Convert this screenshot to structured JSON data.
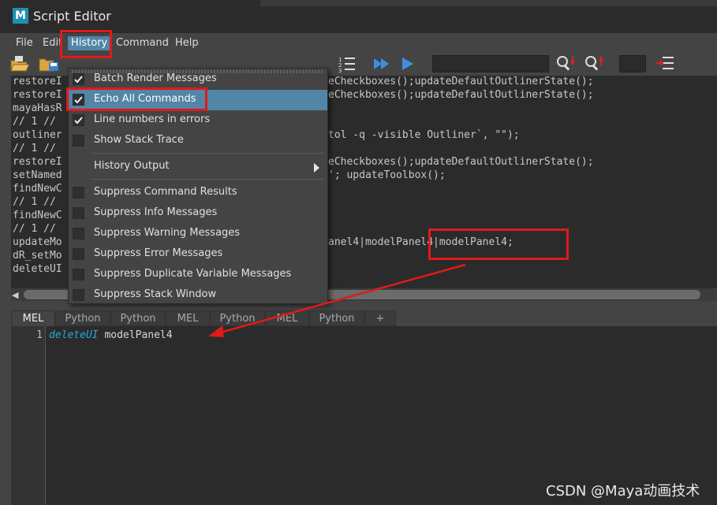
{
  "window": {
    "title": "Script Editor",
    "logo": "M"
  },
  "menubar": {
    "items": [
      "File",
      "Edit",
      "History",
      "Command",
      "Help"
    ],
    "open": "History"
  },
  "history_lines": [
    "restoreI",
    "restoreI",
    "mayaHasR",
    "// 1 //",
    "outliner",
    "// 1 //",
    "restoreI",
    "setNamed",
    "findNewC",
    "// 1 //",
    "findNewC",
    "// 1 //",
    "updateMo",
    "dR_setMo",
    "deleteUI"
  ],
  "history_tail": [
    "eCheckboxes();updateDefaultOutlinerState();",
    "eCheckboxes();updateDefaultOutlinerState();",
    "",
    "",
    "tol -q -visible Outliner`, \"\");",
    "",
    "eCheckboxes();updateDefaultOutlinerState();",
    "'; updateToolbox();",
    "",
    "",
    "",
    "",
    "anel4|modelPanel4|modelPanel4;",
    "",
    ""
  ],
  "dropdown": {
    "items": [
      {
        "label": "Batch Render Messages",
        "checked": true,
        "highlight": false
      },
      {
        "label": "Echo All Commands",
        "checked": true,
        "highlight": true
      },
      {
        "label": "Line numbers in errors",
        "checked": true,
        "highlight": false
      },
      {
        "label": "Show Stack Trace",
        "checked": false,
        "highlight": false
      },
      {
        "label": "History Output",
        "submenu": true
      },
      {
        "label": "Suppress Command Results",
        "checked": false,
        "highlight": false
      },
      {
        "label": "Suppress Info Messages",
        "checked": false,
        "highlight": false
      },
      {
        "label": "Suppress Warning Messages",
        "checked": false,
        "highlight": false
      },
      {
        "label": "Suppress Error Messages",
        "checked": false,
        "highlight": false
      },
      {
        "label": "Suppress Duplicate Variable Messages",
        "checked": false,
        "highlight": false
      },
      {
        "label": "Suppress Stack Window",
        "checked": false,
        "highlight": false
      }
    ]
  },
  "tabs": [
    "MEL",
    "Python",
    "Python",
    "MEL",
    "Python",
    "MEL",
    "Python",
    "+"
  ],
  "active_tab": 0,
  "editor": {
    "line_number": "1",
    "keyword": "deleteUI",
    "argument": "modelPanel4"
  },
  "watermark": "CSDN @Maya动画技术",
  "colors": {
    "accent": "#5285a6",
    "annotation_red": "#e01a1a",
    "keyword": "#25a9d6"
  }
}
